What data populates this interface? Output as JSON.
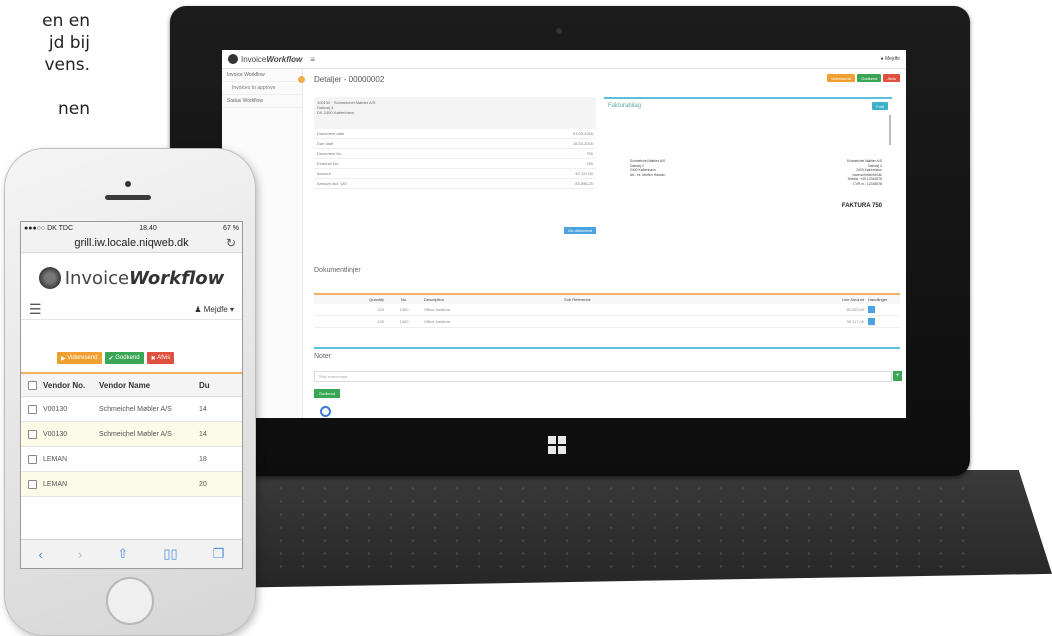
{
  "side_text": {
    "line1": "en en",
    "line2": "jd bij",
    "line3": "vens.",
    "line4": "nen"
  },
  "tablet": {
    "app": {
      "brand_light": "Invoice",
      "brand_bold": "Workflow",
      "menu_icon": "≡",
      "user": "Mejdfe"
    },
    "sidebar": {
      "items": [
        "Invoice Workflow",
        "Invoices to approve",
        "Status Workflow"
      ]
    },
    "page_title": "Detaljer - 00000002",
    "actions": {
      "forward": "Videresend",
      "approve": "Godkend",
      "reject": "Afvis"
    },
    "vendor_address": [
      "100130 · Schmeichel Møbler A/S",
      "Dalsvej 4",
      "DK 2400 København"
    ],
    "detail_rows": [
      {
        "label": "Document date",
        "value": "01.03.2016"
      },
      {
        "label": "Due date",
        "value": "15.03.2016"
      },
      {
        "label": "Document No.",
        "value": "750"
      },
      {
        "label": "External No.",
        "value": "750"
      },
      {
        "label": "Amount",
        "value": "67.117,00"
      },
      {
        "label": "Amount incl. VAT",
        "value": "83.896,25"
      }
    ],
    "detail_button": "Vis dokument",
    "pdf_title": "Fakturabilag",
    "pdf_button": "Fuld",
    "pdf_left": [
      "Schmeichel Møbler A/S",
      "Dalsvej 4",
      "2400 København",
      "",
      "Att.: Hr. Morten Hansen"
    ],
    "pdf_right": [
      "Schmeichel Møbler A/S",
      "Dalsvej 4",
      "2400 København",
      "www.schmeichel.dk",
      "Telefon: +45 12345678",
      "CVR nr.: 12345678"
    ],
    "pdf_heading": "FAKTURA 750",
    "lines_title": "Dokumentlinjer",
    "lines_headers": [
      "Quantity",
      "No.",
      "Description",
      "Sub Reference",
      "Line Amount",
      "Handlinger"
    ],
    "lines": [
      {
        "qty": "100",
        "no": "1400",
        "desc": "Office furniture",
        "ref": "",
        "amount": "28.000,00"
      },
      {
        "qty": "100",
        "no": "1400",
        "desc": "Office furniture",
        "ref": "",
        "amount": "39.117,00"
      }
    ],
    "notes_title": "Noter",
    "notes_placeholder": "Tilføj kommentar",
    "notes_add": "+",
    "approve_small": "Godkend"
  },
  "phone": {
    "status": {
      "carrier": "●●●○○ DK TDC",
      "time": "18.40",
      "battery": "67 %"
    },
    "url": "grill.iw.locale.niqweb.dk",
    "brand_light": "Invoice",
    "brand_bold": "Workflow",
    "user": "Mejdfe",
    "actions": {
      "forward": "Videresend",
      "approve": "Godkend",
      "reject": "Afvis"
    },
    "table_headers": [
      "Vendor No.",
      "Vendor Name",
      "Du"
    ],
    "rows": [
      {
        "no": "V00130",
        "name": "Schmeichel Møbler A/S",
        "d": "14"
      },
      {
        "no": "V00130",
        "name": "Schmeichel Møbler A/S",
        "d": "14"
      },
      {
        "no": "LEMAN",
        "name": "",
        "d": "18"
      },
      {
        "no": "LEMAN",
        "name": "",
        "d": "20"
      }
    ],
    "toolbar": {
      "back": "‹",
      "forward": "›",
      "share": "⇧",
      "bookmarks": "📖",
      "tabs": "❐"
    }
  },
  "colors": {
    "orange": "#f0a030",
    "green": "#3aa655",
    "red": "#e0503e",
    "blue": "#4aa3e0",
    "teal": "#5bc0de"
  }
}
